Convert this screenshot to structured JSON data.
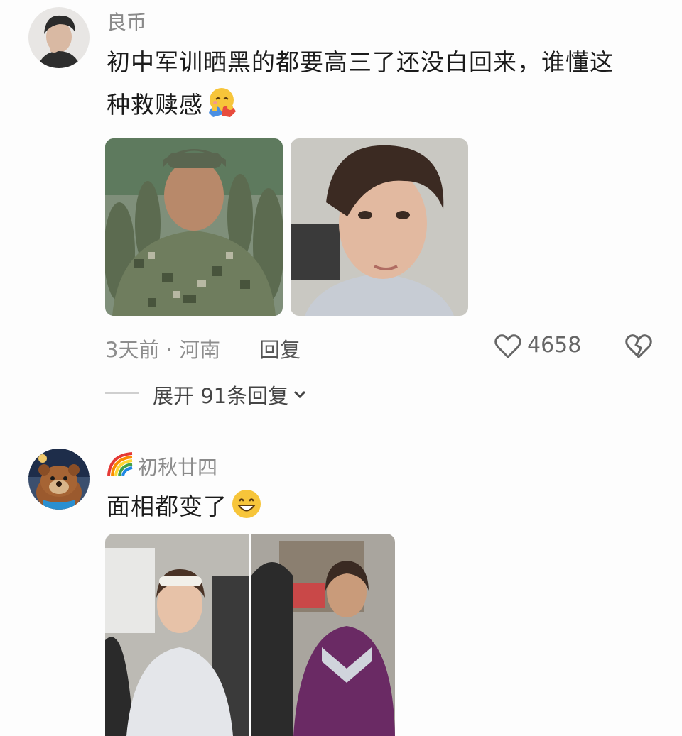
{
  "comments": [
    {
      "username": "良币",
      "text_line1": "初中军训晒黑的都要高三了还没白回来，谁懂这",
      "text_line2": "种救赎感",
      "emoji": "hugging-face",
      "meta": "3天前 · 河南",
      "reply_label": "回复",
      "likes": "4658",
      "expand_label": "展开 91条回复"
    },
    {
      "username": "初秋廿四",
      "username_badge": "rainbow",
      "text_line1": "面相都变了",
      "emoji": "grinning-face"
    }
  ],
  "colors": {
    "meta_gray": "#8d8d8d",
    "text": "#1b1b1b",
    "background": "#fdfdfd"
  }
}
